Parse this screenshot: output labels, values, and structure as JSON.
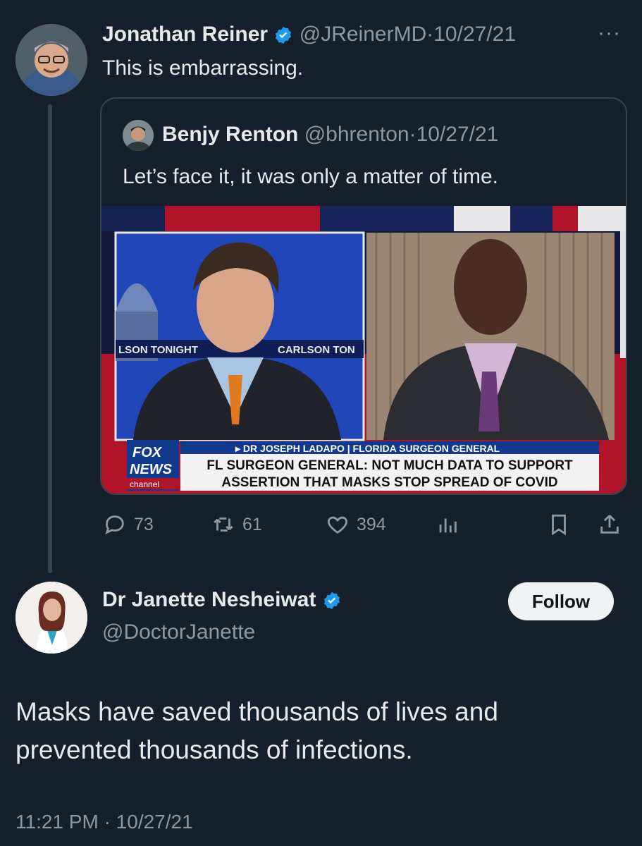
{
  "colors": {
    "background": "#15202b",
    "text": "#e7e9ea",
    "muted": "#8b98a5",
    "verified": "#1d9bf0",
    "border": "#38444d"
  },
  "tweet": {
    "author_name": "Jonathan Reiner",
    "handle": "@JReinerMD",
    "date": "10/27/21",
    "more_icon": "more-icon",
    "text": "This is embarrassing."
  },
  "quote": {
    "author_name": "Benjy Renton",
    "handle": "@bhrenton",
    "date": "10/27/21",
    "text": "Let’s face it, it was only a matter of time.",
    "media": {
      "banner_left": "LSON TONIGHT",
      "banner_right": "CARLSON TON",
      "network_line1": "FOX",
      "network_line2": "NEWS",
      "network_line3": "channel",
      "lower_third_name": "▸ DR JOSEPH LADAPO | FLORIDA SURGEON GENERAL",
      "headline_line1": "FL SURGEON GENERAL: NOT MUCH DATA TO SUPPORT",
      "headline_line2": "ASSERTION THAT MASKS STOP SPREAD OF COVID"
    }
  },
  "actions": {
    "replies": "73",
    "retweets": "61",
    "likes": "394"
  },
  "reply": {
    "author_name": "Dr Janette Nesheiwat",
    "handle": "@DoctorJanette",
    "follow_label": "Follow",
    "text_line1": "Masks have saved thousands of lives and",
    "text_line2": "prevented thousands of infections.",
    "time": "11:21 PM",
    "date": "10/27/21"
  }
}
